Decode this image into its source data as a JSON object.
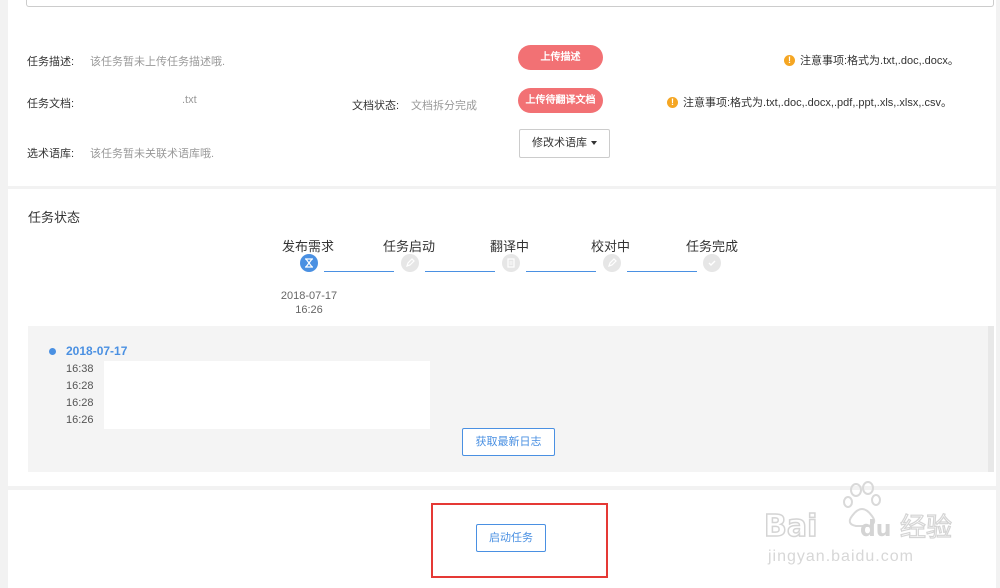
{
  "task_info": {
    "description_label": "任务描述:",
    "description_value": "该任务暂未上传任务描述哦.",
    "document_label": "任务文档:",
    "document_value": ".txt",
    "doc_status_label": "文档状态:",
    "doc_status_value": "文档拆分完成",
    "glossary_label": "选术语库:",
    "glossary_value": "该任务暂未关联术语库哦.",
    "upload_description_button": "上传描述",
    "upload_document_button": "上传待翻译文档",
    "modify_glossary_button": "修改术语库",
    "note_description": "注意事项:格式为.txt,.doc,.docx。",
    "note_document": "注意事项:格式为.txt,.doc,.docx,.pdf,.ppt,.xls,.xlsx,.csv。",
    "warn_symbol": "!"
  },
  "task_status": {
    "title": "任务状态",
    "steps": [
      {
        "label": "发布需求",
        "icon": "hourglass-icon",
        "active": true
      },
      {
        "label": "任务启动",
        "icon": "pencil-icon",
        "active": false
      },
      {
        "label": "翻译中",
        "icon": "document-icon",
        "active": false
      },
      {
        "label": "校对中",
        "icon": "pencil-icon",
        "active": false
      },
      {
        "label": "任务完成",
        "icon": "check-icon",
        "active": false
      }
    ],
    "publish_date": "2018-07-17",
    "publish_time": "16:26"
  },
  "log": {
    "date": "2018-07-17",
    "times": [
      "16:38",
      "16:28",
      "16:28",
      "16:26"
    ],
    "fetch_button": "获取最新日志"
  },
  "actions": {
    "start_button": "启动任务"
  },
  "watermark": {
    "logo_text": "Baidu经验",
    "url": "jingyan.baidu.com"
  },
  "colors": {
    "accent": "#4a90e2",
    "pill": "#f27174",
    "warning": "#f5a623",
    "highlight": "#e53935"
  }
}
